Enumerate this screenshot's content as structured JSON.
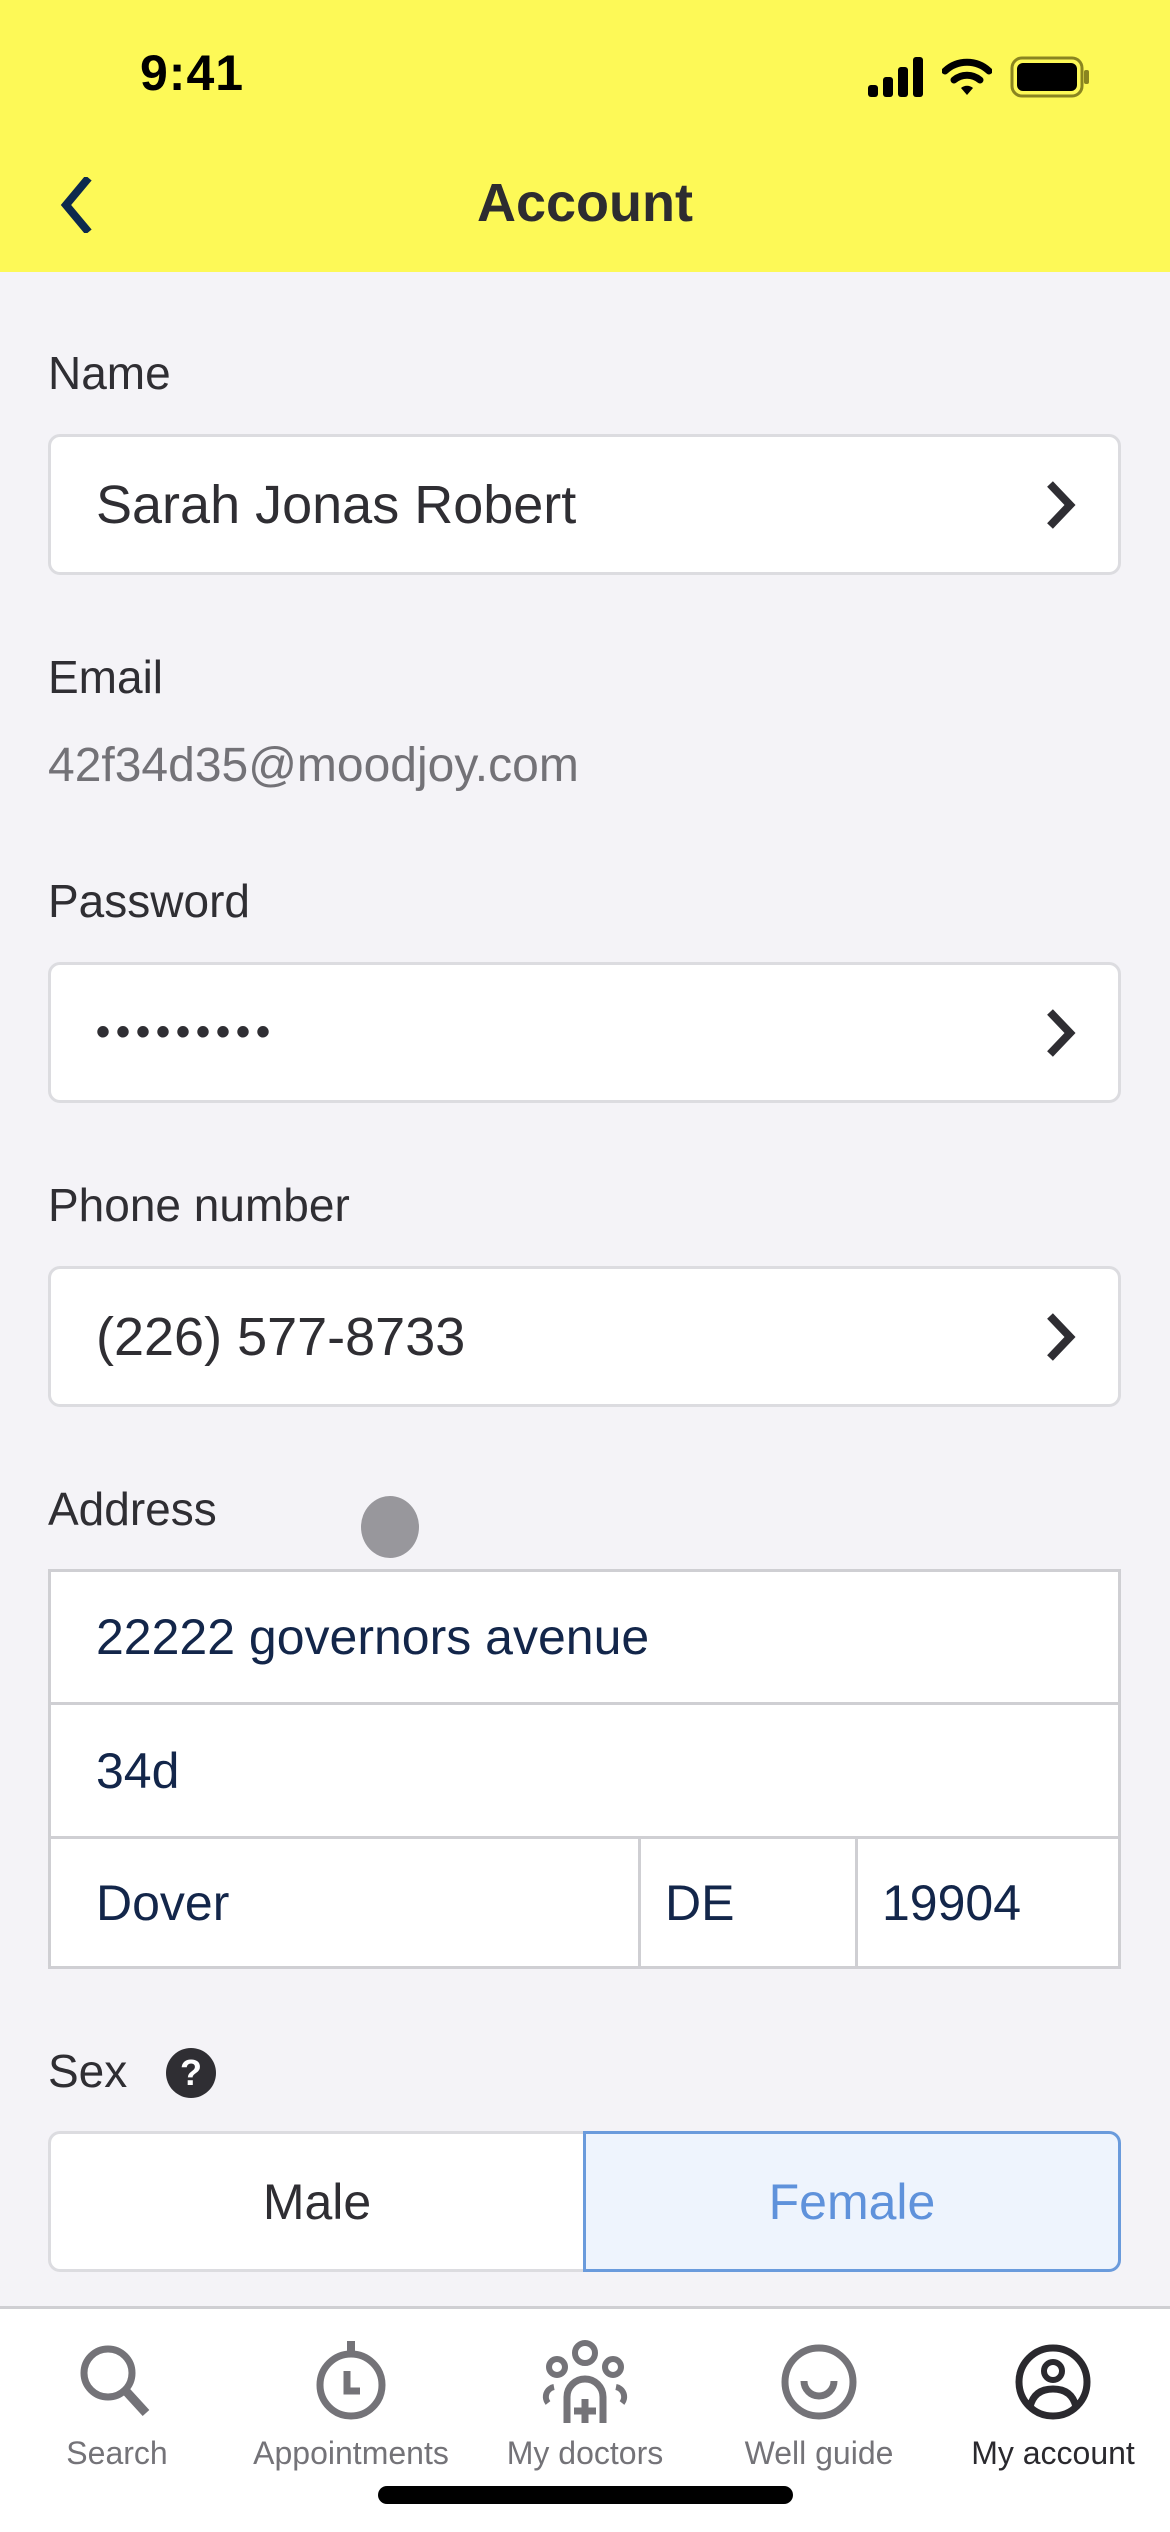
{
  "status_bar": {
    "time": "9:41",
    "icons": [
      "cellular-signal-icon",
      "wifi-icon",
      "battery-icon"
    ]
  },
  "nav": {
    "title": "Account",
    "back_icon": "chevron-left-icon"
  },
  "colors": {
    "header_bg": "#fdf957",
    "page_bg": "#f4f3f7",
    "selected_accent": "#5f92db",
    "selected_bg": "#eef4fd",
    "address_text": "#13264a"
  },
  "form": {
    "name": {
      "label": "Name",
      "value": "Sarah Jonas Robert"
    },
    "email": {
      "label": "Email",
      "value": "42f34d35@moodjoy.com"
    },
    "password": {
      "label": "Password",
      "value": "•••••••••"
    },
    "phone": {
      "label": "Phone number",
      "value": "(226) 577-8733"
    },
    "address": {
      "label": "Address",
      "line1": "22222 governors avenue",
      "line2": "34d",
      "city": "Dover",
      "state": "DE",
      "zip": "19904"
    },
    "sex": {
      "label": "Sex",
      "help_icon": "question-circle-icon",
      "help_glyph": "?",
      "options": [
        "Male",
        "Female"
      ],
      "selected": "Female"
    }
  },
  "tabbar": {
    "items": [
      {
        "label": "Search",
        "icon": "search-icon",
        "active": false
      },
      {
        "label": "Appointments",
        "icon": "stopwatch-icon",
        "active": false
      },
      {
        "label": "My doctors",
        "icon": "doctors-group-icon",
        "active": false
      },
      {
        "label": "Well guide",
        "icon": "smile-circle-icon",
        "active": false
      },
      {
        "label": "My account",
        "icon": "account-circle-icon",
        "active": true
      }
    ]
  }
}
